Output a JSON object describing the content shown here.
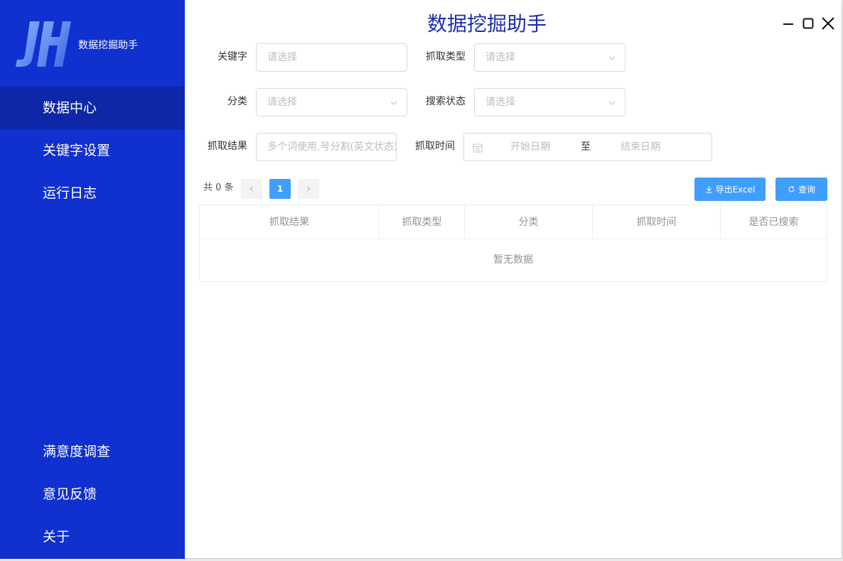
{
  "app": {
    "title": "数据挖掘助手",
    "brand_name": "数据挖掘助手"
  },
  "sidebar": {
    "items": [
      {
        "label": "数据中心",
        "active": true
      },
      {
        "label": "关键字设置",
        "active": false
      },
      {
        "label": "运行日志",
        "active": false
      }
    ],
    "bottom_items": [
      {
        "label": "满意度调查"
      },
      {
        "label": "意见反馈"
      },
      {
        "label": "关于"
      }
    ]
  },
  "filters": {
    "keyword": {
      "label": "关键字",
      "placeholder": "请选择"
    },
    "fetch_type": {
      "label": "抓取类型",
      "placeholder": "请选择"
    },
    "category": {
      "label": "分类",
      "placeholder": "请选择"
    },
    "search_status": {
      "label": "搜索状态",
      "placeholder": "请选择"
    },
    "fetch_result": {
      "label": "抓取结果",
      "placeholder": "多个词使用,号分割(英文状态)"
    },
    "fetch_time": {
      "label": "抓取时间",
      "start_placeholder": "开始日期",
      "separator": "至",
      "end_placeholder": "结束日期"
    }
  },
  "pagination": {
    "total_text": "共 0 条",
    "current_page": "1",
    "prev_icon": "chevron-left-icon",
    "next_icon": "chevron-right-icon"
  },
  "actions": {
    "export_label": "导出Excel",
    "query_label": "查询"
  },
  "table": {
    "columns": [
      "抓取结果",
      "抓取类型",
      "分类",
      "抓取时间",
      "是否已搜索"
    ],
    "empty_text": "暂无数据"
  },
  "colors": {
    "sidebar_bg": "#1030cf",
    "sidebar_active": "#0d27a8",
    "accent": "#409eff",
    "title": "#1c2fa8"
  }
}
